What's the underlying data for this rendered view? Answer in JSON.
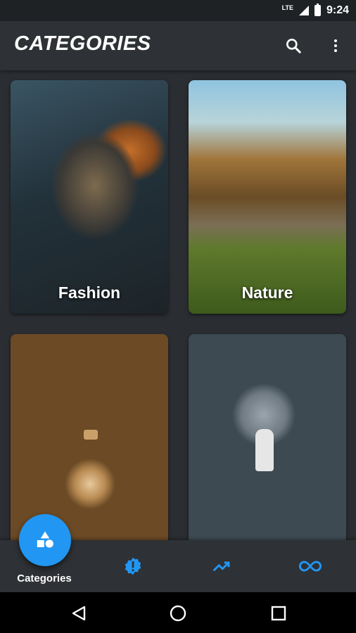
{
  "status_bar": {
    "network": "LTE",
    "time": "9:24"
  },
  "app_bar": {
    "title": "CATEGORIES",
    "search_icon": "search-icon",
    "more_icon": "more-vert-icon"
  },
  "categories": [
    {
      "label": "Fashion"
    },
    {
      "label": "Nature"
    },
    {
      "label": ""
    },
    {
      "label": ""
    }
  ],
  "bottom_nav": {
    "items": [
      {
        "label": "Categories",
        "icon": "categories-shapes-icon",
        "active": true
      },
      {
        "label": "",
        "icon": "new-badge-icon"
      },
      {
        "label": "",
        "icon": "trending-icon"
      },
      {
        "label": "",
        "icon": "infinity-icon"
      }
    ]
  },
  "colors": {
    "accent": "#2196f3",
    "background": "#2a2d31",
    "bar": "#2e3135"
  }
}
